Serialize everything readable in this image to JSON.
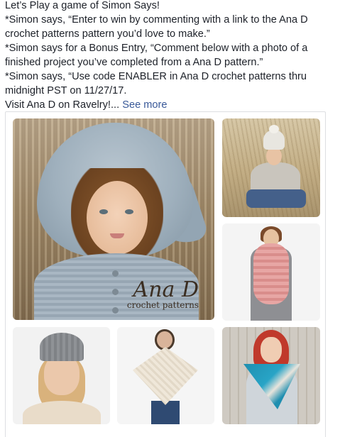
{
  "post": {
    "lines": [
      "Let’s Play a game of Simon Says!",
      "*Simon says, “Enter to win by commenting with a link to the Ana D",
      "crochet patterns pattern you’d love to make.”",
      "*Simon says for a Bonus Entry, “Comment below with a photo of a",
      "finished project you’ve completed from a Ana D pattern.”",
      "*Simon says, “Use code ENABLER in Ana D crochet patterns thru",
      "midnight PST on 11/27/17.",
      "Visit Ana D on Ravelry!..."
    ],
    "see_more": "See more"
  },
  "gallery": {
    "main_photo": {
      "subject": "child-in-grey-crochet-hood",
      "watermark_brand": "Ana D",
      "watermark_sub": "crochet patterns"
    },
    "photos": [
      "woman-in-field-white-beanie",
      "pink-infinity-scarf",
      "woman-grey-beanie",
      "cream-lace-poncho",
      "red-hair-blue-scarf"
    ]
  }
}
